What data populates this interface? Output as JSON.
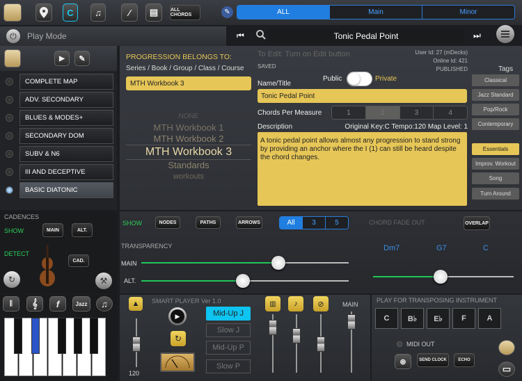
{
  "toolbar": {
    "all_chords_label": "ALL CHORDS",
    "filter_tabs": [
      "ALL",
      "Main",
      "Minor"
    ],
    "selected_filter": "ALL"
  },
  "mode_bar": {
    "play_mode_label": "Play Mode",
    "current_title": "Tonic Pedal Point"
  },
  "sidebar": {
    "items": [
      {
        "label": "COMPLETE MAP",
        "selected": false
      },
      {
        "label": "ADV. SECONDARY",
        "selected": false
      },
      {
        "label": "BLUES & MODES+",
        "selected": false
      },
      {
        "label": "SECONDARY DOM",
        "selected": false
      },
      {
        "label": "SUBV & N6",
        "selected": false
      },
      {
        "label": "III AND DECEPTIVE",
        "selected": false
      },
      {
        "label": "BASIC DIATONIC",
        "selected": true
      }
    ]
  },
  "progression": {
    "belongs_to_label": "PROGRESSION BELONGS TO:",
    "hierarchy_label": "Series / Book / Group / Class / Course",
    "selected_group": "MTH Workbook 3",
    "picker_items": [
      "NONE",
      "MTH Workbook 1",
      "MTH Workbook 2",
      "MTH Workbook 3",
      "Standards",
      "workouts"
    ]
  },
  "details": {
    "edit_hint": "To Edit: Turn on Edit button",
    "saved_label": "SAVED",
    "user_id": "User Id: 27 (mDecks)",
    "online_id": "Online Id: 421",
    "published_label": "PUBLISHED",
    "tags_label": "Tags",
    "name_label": "Name/Title",
    "public_label": "Public",
    "private_label": "Private",
    "name_value": "Tonic Pedal Point",
    "cpm_label": "Chords Per Measure",
    "cpm_options": [
      "1",
      "2",
      "3",
      "4"
    ],
    "cpm_selected": "2",
    "description_label": "Description",
    "meta_info": "Original Key:C Tempo:120 Map Level: 1",
    "description": "A tonic pedal point allows almost any progression to stand strong by providing an anchor where the I (1) can still be heard despite the chord changes."
  },
  "tags": [
    {
      "label": "Classical",
      "selected": false
    },
    {
      "label": "Jazz Standard",
      "selected": false
    },
    {
      "label": "Pop/Rock",
      "selected": false
    },
    {
      "label": "Contemporary",
      "selected": false
    },
    {
      "label": "Essentials",
      "selected": true
    },
    {
      "label": "Improv. Workout",
      "selected": false
    },
    {
      "label": "Song",
      "selected": false
    },
    {
      "label": "Turn Around",
      "selected": false
    }
  ],
  "cadences": {
    "title": "CADENCES",
    "show_label": "SHOW",
    "main_label": "MAIN",
    "alt_label": "ALT.",
    "detect_label": "DETECT",
    "cad_label": "CAD."
  },
  "show_bar": {
    "show_label": "SHOW",
    "nodes_label": "NODES",
    "paths_label": "PATHS",
    "arrows_label": "ARROWS",
    "segments": [
      "All",
      "3",
      "5"
    ],
    "selected_segment": "All",
    "chord_fade_label": "CHORD FADE OUT",
    "overlap_label": "OVERLAP"
  },
  "transparency": {
    "title": "TRANSPARENCY",
    "main_label": "MAIN",
    "alt_label": "ALT.",
    "main_level": 0.66,
    "alt_level": 0.49
  },
  "fade": {
    "chords": [
      "Dm7",
      "G7",
      "C"
    ],
    "level": 0.48
  },
  "smart_player": {
    "title": "SMART PLAYER Ver 1.0",
    "styles": [
      "Mid-Up J",
      "Slow J",
      "Mid-Up P",
      "Slow P"
    ],
    "selected_style": "Mid-Up J",
    "tempo": "120",
    "jazz_label": "Jazz",
    "main_label": "MAIN"
  },
  "transposing": {
    "title": "PLAY FOR TRANSPOSING INSTRUMENT",
    "keys": [
      "C",
      "B♭",
      "E♭",
      "F",
      "A"
    ],
    "selected_key": "C",
    "midi_out_label": "MIDI OUT",
    "send_clock_label": "SEND CLOCK",
    "echo_label": "ECHO"
  },
  "colors": {
    "accent_blue": "#1f7ee0",
    "highlight_yellow": "#e6c657",
    "slider_green": "#21c65a",
    "chord_blue": "#3a8eea",
    "cyan": "#0ec4f0"
  }
}
